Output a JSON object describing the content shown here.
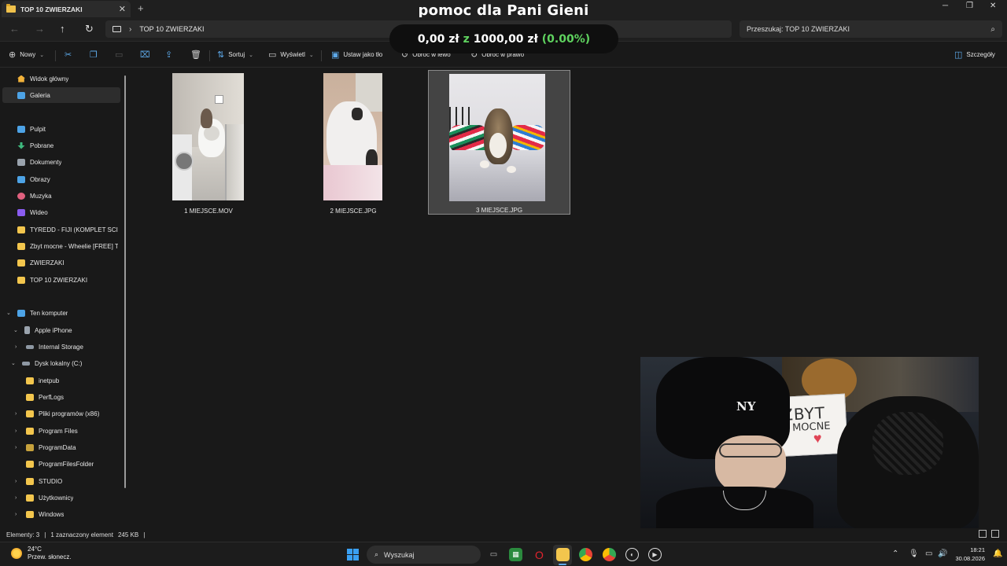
{
  "window": {
    "tab_title": "TOP 10 ZWIERZAKI",
    "new_tab": "+",
    "minimize": "─",
    "maximize": "❐",
    "close": "✕"
  },
  "overlay": {
    "title": "pomoc dla Pani Gieni",
    "amount_current": "0,00 zł",
    "amount_sep": "z",
    "amount_goal": "1000,00 zł",
    "amount_percent": "(0.00%)",
    "percent_color": "#5fd35f"
  },
  "address": {
    "back": "←",
    "forward": "→",
    "up": "↑",
    "refresh": "↻",
    "separator": "›",
    "path": "TOP 10 ZWIERZAKI",
    "search_placeholder": "Przeszukaj: TOP 10 ZWIERZAKI"
  },
  "commands": {
    "new": "Nowy",
    "sort": "Sortuj",
    "view": "Wyświetl",
    "set_background": "Ustaw jako tło",
    "rotate_left": "Obróć w lewo",
    "rotate_right": "Obróć w prawo",
    "more": "•••",
    "details": "Szczegóły"
  },
  "nav": {
    "items": [
      {
        "label": "Widok główny",
        "icon": "home-icon"
      },
      {
        "label": "Galeria",
        "icon": "gallery-icon"
      },
      {
        "label": "Pulpit",
        "icon": "desktop-icon"
      },
      {
        "label": "Pobrane",
        "icon": "download-icon"
      },
      {
        "label": "Dokumenty",
        "icon": "documents-icon"
      },
      {
        "label": "Obrazy",
        "icon": "pictures-icon"
      },
      {
        "label": "Muzyka",
        "icon": "music-icon"
      },
      {
        "label": "Wideo",
        "icon": "video-icon"
      },
      {
        "label": "TYREDD - FIJI (KOMPLET SCIEŻEK)",
        "icon": "folder-icon"
      },
      {
        "label": "Zbyt mocne - Wheelie [FREE] Type Beat",
        "icon": "folder-icon"
      },
      {
        "label": "ZWIERZAKI",
        "icon": "folder-icon"
      },
      {
        "label": "TOP 10 ZWIERZAKI",
        "icon": "folder-icon"
      },
      {
        "label": "Ten komputer",
        "icon": "computer-icon"
      },
      {
        "label": "Apple iPhone",
        "icon": "phone-icon"
      },
      {
        "label": "Internal Storage",
        "icon": "storage-icon"
      },
      {
        "label": "Dysk lokalny (C:)",
        "icon": "drive-icon"
      },
      {
        "label": "inetpub",
        "icon": "folder-icon"
      },
      {
        "label": "PerfLogs",
        "icon": "folder-icon"
      },
      {
        "label": "Pliki programów (x86)",
        "icon": "folder-icon"
      },
      {
        "label": "Program Files",
        "icon": "folder-icon"
      },
      {
        "label": "ProgramData",
        "icon": "folder-icon"
      },
      {
        "label": "ProgramFilesFolder",
        "icon": "folder-icon"
      },
      {
        "label": "STUDIO",
        "icon": "folder-icon"
      },
      {
        "label": "Użytkownicy",
        "icon": "folder-icon"
      },
      {
        "label": "Windows",
        "icon": "folder-icon"
      }
    ]
  },
  "files": [
    {
      "name": "1 MIEJSCE.MOV"
    },
    {
      "name": "2 MIEJSCE.JPG"
    },
    {
      "name": "3 MIEJSCE.JPG"
    }
  ],
  "webcam": {
    "sign_line1": "ZBYT",
    "sign_line2": "MOCNE",
    "hat_logo": "NY"
  },
  "status": {
    "items": "Elementy: 3",
    "selected": "1 zaznaczony element",
    "size": "245 KB"
  },
  "taskbar": {
    "temperature": "24°C",
    "weather": "Przew. słonecz.",
    "search": "Wyszukaj",
    "time": "18:21",
    "date": "30.08.2026"
  }
}
